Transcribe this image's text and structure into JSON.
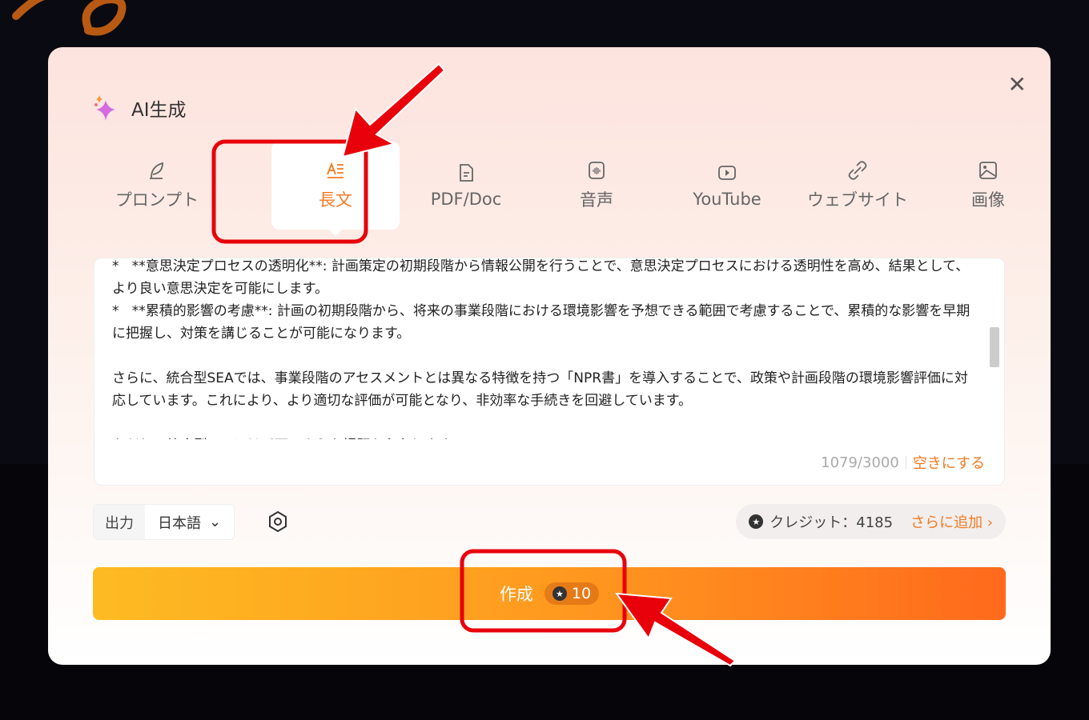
{
  "dialog": {
    "title": "AI生成",
    "close_icon": "close-icon"
  },
  "tabs": [
    {
      "label": "プロンプト",
      "icon": "feather-icon"
    },
    {
      "label": "長文",
      "icon": "long-text-icon",
      "active": true
    },
    {
      "label": "PDF/Doc",
      "icon": "document-icon"
    },
    {
      "label": "音声",
      "icon": "audio-icon"
    },
    {
      "label": "YouTube",
      "icon": "youtube-icon"
    },
    {
      "label": "ウェブサイト",
      "icon": "link-icon"
    },
    {
      "label": "画像",
      "icon": "image-icon"
    }
  ],
  "textbox": {
    "content": "*   **意思決定プロセスの透明化**: 計画策定の初期段階から情報公開を行うことで、意思決定プロセスにおける透明性を高め、結果として、より良い意思決定を可能にします。\n*   **累積的影響の考慮**: 計画の初期段階から、将来の事業段階における環境影響を予想できる範囲で考慮することで、累積的な影響を早期に把握し、対策を講じることが可能になります。\n\nさらに、統合型SEAでは、事業段階のアセスメントとは異なる特徴を持つ「NPR書」を導入することで、政策や計画段階の環境影響評価に対応しています。これにより、より適切な評価が可能となり、非効率な手続きを回避しています。\n\nただし、統合型SEAには以下のような課題も存在します。",
    "counter": "1079/3000",
    "clear_label": "空きにする"
  },
  "output": {
    "label": "出力",
    "language": "日本語"
  },
  "credits": {
    "label": "クレジット：4185",
    "add_label": "さらに追加 ›"
  },
  "create": {
    "label": "作成",
    "cost": "10"
  },
  "colors": {
    "accent": "#f27a22",
    "annotation": "#e8000b"
  }
}
